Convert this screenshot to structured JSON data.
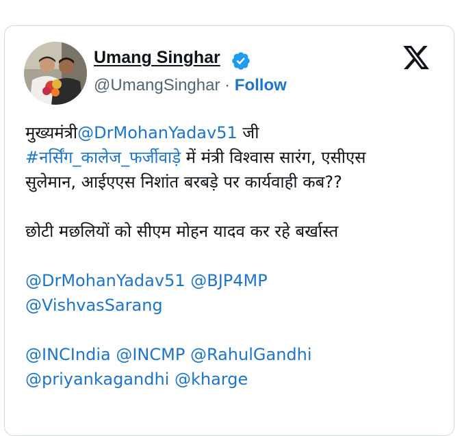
{
  "author": {
    "name": "Umang Singhar",
    "handle": "@UmangSinghar",
    "separator": " · ",
    "follow_label": "Follow",
    "verified_icon": "verified-badge-icon",
    "avatar_icon": "profile-photo"
  },
  "platform_icon": "x-logo-icon",
  "colors": {
    "link": "#1d74c9",
    "text": "#0f1419",
    "muted": "#536471",
    "border": "#cfd9de",
    "verified": "#1d9bf0"
  },
  "tweet": {
    "line1_prefix": "मुख्यमंत्री",
    "mention_cm": "@DrMohanYadav51",
    "line1_suffix": " जी",
    "hashtag": "#नर्सिंग_कालेज_फर्जीवाड़े",
    "line2_suffix": " में मंत्री विश्वास सारंग, एसीएस",
    "line3": "सुलेमान, आईएएस निशांत बरबड़े पर कार्यवाही कब??",
    "line4": "छोटी मछलियों को सीएम मोहन यादव कर रहे बर्खास्त",
    "mention_a": "@DrMohanYadav51",
    "mention_b": "@BJP4MP",
    "mention_c": "@VishvasSarang",
    "mention_d": "@INCIndia",
    "mention_e": "@INCMP",
    "mention_f": "@RahulGandhi",
    "mention_g": "@priyankagandhi",
    "mention_h": "@kharge"
  }
}
